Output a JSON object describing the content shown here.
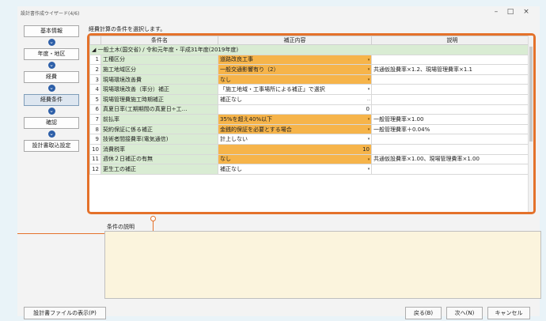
{
  "window": {
    "title": "設計書作成ウイザード(4/6)",
    "controls": {
      "minimize": "–",
      "maximize": "□",
      "close": "×"
    }
  },
  "nav": {
    "items": [
      {
        "label": "基本情報",
        "active": false
      },
      {
        "label": "年度・地区",
        "active": false
      },
      {
        "label": "経費",
        "active": false
      },
      {
        "label": "経費条件",
        "active": true
      },
      {
        "label": "確認",
        "active": false
      },
      {
        "label": "設計書取込設定",
        "active": false
      }
    ],
    "arrow_glyph": "⌄"
  },
  "instruction": "経費計算の条件を選択します。",
  "grid": {
    "headers": {
      "name": "条件名",
      "value": "補正内容",
      "desc": "説明"
    },
    "group_row": "◢ 一般土木(国交省) / 令和元年度・平成31年度(2019年度)",
    "rows": [
      {
        "num": "1",
        "name": "工種区分",
        "value": "道路改良工事",
        "selected": true,
        "dropdown": true,
        "desc": ""
      },
      {
        "num": "2",
        "name": "施工地域区分",
        "value": "一般交通影響有り（2）",
        "selected": true,
        "dropdown": true,
        "desc": "共通仮設費率×1.2、現場管理費率×1.1"
      },
      {
        "num": "3",
        "name": "現場環境改善費",
        "value": "なし",
        "selected": true,
        "dropdown": true,
        "desc": ""
      },
      {
        "num": "4",
        "name": "現場環境改善（率分）補正",
        "value": "「施工地域・工事場所による補正」で選択",
        "selected": false,
        "dropdown": true,
        "desc": ""
      },
      {
        "num": "5",
        "name": "現場管理費施工時期補正",
        "value": "補正なし",
        "selected": false,
        "dropdown": false,
        "ellipsis": "…",
        "desc": ""
      },
      {
        "num": "6",
        "name": "真夏日率(工期期間の真夏日÷工…",
        "value": "0",
        "selected": false,
        "dropdown": false,
        "right": true,
        "desc": ""
      },
      {
        "num": "7",
        "name": "前払率",
        "value": "35%を超え40%以下",
        "selected": true,
        "dropdown": true,
        "desc": "一般管理費率×1.00"
      },
      {
        "num": "8",
        "name": "契約保証に係る補正",
        "value": "金銭的保証を必要とする場合",
        "selected": true,
        "dropdown": true,
        "desc": "一般管理費率＋0.04%"
      },
      {
        "num": "9",
        "name": "技術者間接費率(電気通信)",
        "value": "計上しない",
        "selected": false,
        "dropdown": true,
        "desc": ""
      },
      {
        "num": "10",
        "name": "消費税率",
        "value": "10",
        "selected": true,
        "dropdown": false,
        "right": true,
        "desc": ""
      },
      {
        "num": "11",
        "name": "週休２日補正の有無",
        "value": "なし",
        "selected": true,
        "dropdown": true,
        "desc": "共通仮設費率×1.00、現場管理費率×1.00"
      },
      {
        "num": "12",
        "name": "更生工の補正",
        "value": "補正なし",
        "selected": false,
        "dropdown": true,
        "desc": ""
      }
    ]
  },
  "explanation_label": "条件の説明",
  "buttons": {
    "show_file": "設計書ファイルの表示(P)",
    "back": "戻る(B)",
    "next": "次へ(N)",
    "cancel": "キャンセル"
  }
}
